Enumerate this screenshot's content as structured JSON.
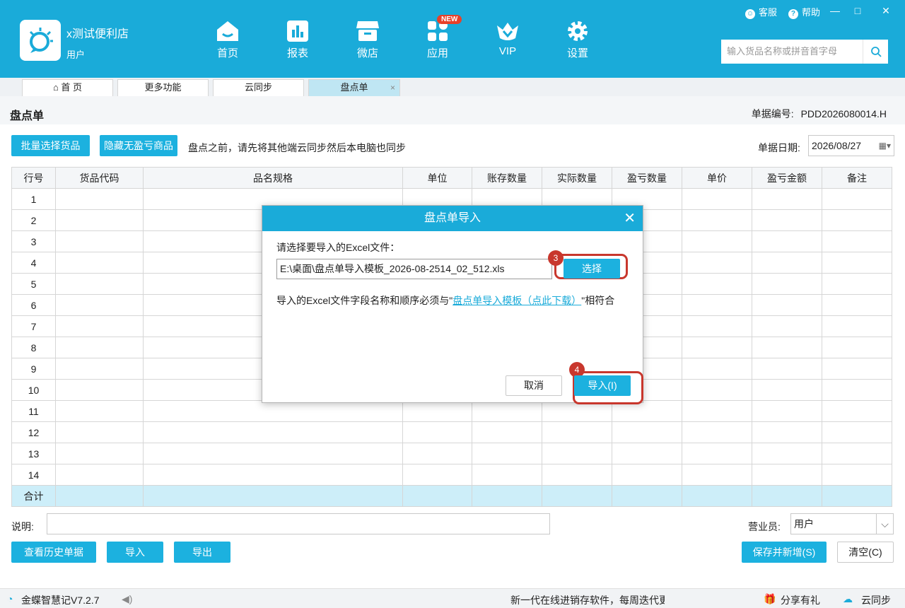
{
  "app": {
    "store_name": "x测试便利店",
    "user": "用户",
    "nav": [
      {
        "label": "首页",
        "icon": "home-icon"
      },
      {
        "label": "报表",
        "icon": "report-icon"
      },
      {
        "label": "微店",
        "icon": "shop-icon"
      },
      {
        "label": "应用",
        "icon": "apps-icon",
        "badge": "NEW"
      },
      {
        "label": "VIP",
        "icon": "vip-icon"
      },
      {
        "label": "设置",
        "icon": "gear-icon"
      }
    ],
    "top_links": {
      "service": "客服",
      "help": "帮助"
    },
    "window_controls": {
      "min": "—",
      "max": "□",
      "close": "✕"
    },
    "search": {
      "placeholder": "输入货品名称或拼音首字母"
    }
  },
  "tabs": [
    {
      "label": "⌂ 首 页"
    },
    {
      "label": "更多功能"
    },
    {
      "label": "云同步"
    },
    {
      "label": "盘点单",
      "active": true,
      "close": "×"
    }
  ],
  "page": {
    "title": "盘点单",
    "doc_no_label": "单据编号:",
    "doc_no": "PDD2026080014.H",
    "btn_batch": "批量选择货品",
    "btn_hide": "隐藏无盈亏商品",
    "hint": "盘点之前，请先将其他端云同步然后本电脑也同步",
    "date_label": "单据日期:",
    "date": "2026/08/27"
  },
  "grid": {
    "columns": [
      "行号",
      "货品代码",
      "品名规格",
      "单位",
      "账存数量",
      "实际数量",
      "盈亏数量",
      "单价",
      "盈亏金额",
      "备注"
    ],
    "rows": [
      "1",
      "2",
      "3",
      "4",
      "5",
      "6",
      "7",
      "8",
      "9",
      "10",
      "11",
      "12",
      "13",
      "14"
    ],
    "total_label": "合计"
  },
  "footer": {
    "remark_label": "说明:",
    "salesperson_label": "营业员:",
    "salesperson": "用户",
    "btn_history": "查看历史单据",
    "btn_import": "导入",
    "btn_export": "导出",
    "btn_save_new": "保存并新增(S)",
    "btn_clear": "清空(C)"
  },
  "statusbar": {
    "version": "金蝶智慧记V7.2.7",
    "marquee": "新一代在线进销存软件，每周迭代更",
    "share": "分享有礼",
    "cloud": "云同步"
  },
  "modal": {
    "title": "盘点单导入",
    "close": "✕",
    "select_label": "请选择要导入的Excel文件：",
    "file_path": "E:\\桌面\\盘点单导入模板_2026-08-2514_02_512.xls",
    "btn_choose": "选择",
    "note_prefix": "导入的Excel文件字段名称和顺序必须与\"",
    "note_link": "盘点单导入模板（点此下载）",
    "note_suffix": "\"相符合",
    "btn_cancel": "取消",
    "btn_import": "导入(I)",
    "step_choose": "3",
    "step_import": "4"
  },
  "colors": {
    "accent": "#1aabd9",
    "highlight": "#c8372d",
    "total_row": "#cdeef9"
  }
}
